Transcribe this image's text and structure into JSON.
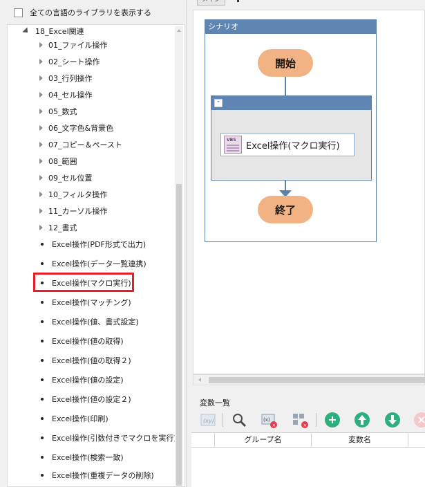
{
  "left_panel": {
    "show_all_label": "全ての言語のライブラリを表示する",
    "tree": {
      "parent": "18_Excel関連",
      "folders": [
        "01_ファイル操作",
        "02_シート操作",
        "03_行列操作",
        "04_セル操作",
        "05_数式",
        "06_文字色&背景色",
        "07_コピー＆ペースト",
        "08_範囲",
        "09_セル位置",
        "10_フィルタ操作",
        "11_カーソル操作",
        "12_書式"
      ],
      "items": [
        "Excel操作(PDF形式で出力)",
        "Excel操作(データ一覧連携)",
        "Excel操作(マクロ実行)",
        "Excel操作(マッチング)",
        "Excel操作(値、書式設定)",
        "Excel操作(値の取得)",
        "Excel操作(値の取得２)",
        "Excel操作(値の設定)",
        "Excel操作(値の設定２)",
        "Excel操作(印刷)",
        "Excel操作(引数付きでマクロを実行)",
        "Excel操作(検索一致)",
        "Excel操作(重複データの削除)"
      ],
      "highlighted_item": "Excel操作(マクロ実行)"
    }
  },
  "tab": {
    "label": "メイン"
  },
  "scenario": {
    "title": "シナリオ",
    "start_label": "開始",
    "end_label": "終了",
    "group_toggle": "-",
    "action_icon_text": "VBS",
    "action_label": "Excel操作(マクロ実行)"
  },
  "variables": {
    "title": "変数一覧",
    "columns": [
      "グループ名",
      "変数名"
    ],
    "toolbar_icons": [
      "xy-variable-icon",
      "search-icon",
      "delete-variable-icon",
      "delete-grid-icon",
      "add-icon",
      "move-up-icon",
      "move-down-icon",
      "remove-icon"
    ]
  },
  "colors": {
    "accent_blue": "#5f86b3",
    "node_orange": "#f2b384",
    "highlight_red": "#e3202a",
    "add_green": "#2fae7e"
  }
}
